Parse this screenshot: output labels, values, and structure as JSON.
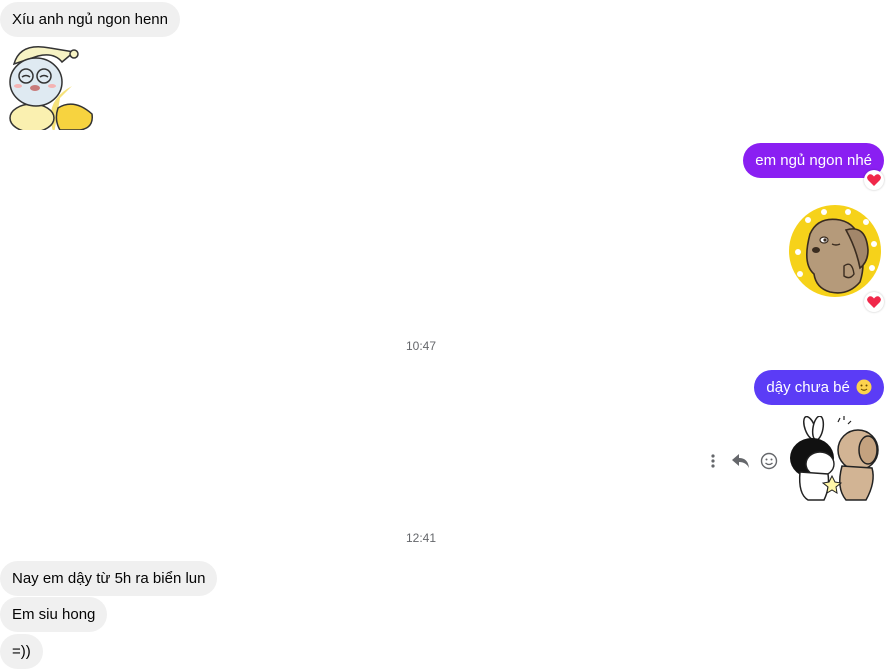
{
  "messages": {
    "m1": "Xíu anh ngủ ngon henn",
    "m2": "em ngủ ngon nhé",
    "m3": "dậy chưa bé",
    "m4": "Nay em dậy từ 5h ra biển lun",
    "m5": "Em siu hong",
    "m6": "=))"
  },
  "timestamps": {
    "t1": "10:47",
    "t2": "12:41"
  },
  "icons": {
    "reaction": "red-heart-icon",
    "emoji": "slightly-smiling-face-icon",
    "actions": [
      "more-options-icon",
      "reply-icon",
      "react-smiley-icon"
    ]
  },
  "colors": {
    "incoming_bubble": "#f0f0f0",
    "outgoing_bubble_1": "#8a1ff2",
    "outgoing_bubble_2": "#5b3cf6",
    "timestamp": "#65676b"
  }
}
